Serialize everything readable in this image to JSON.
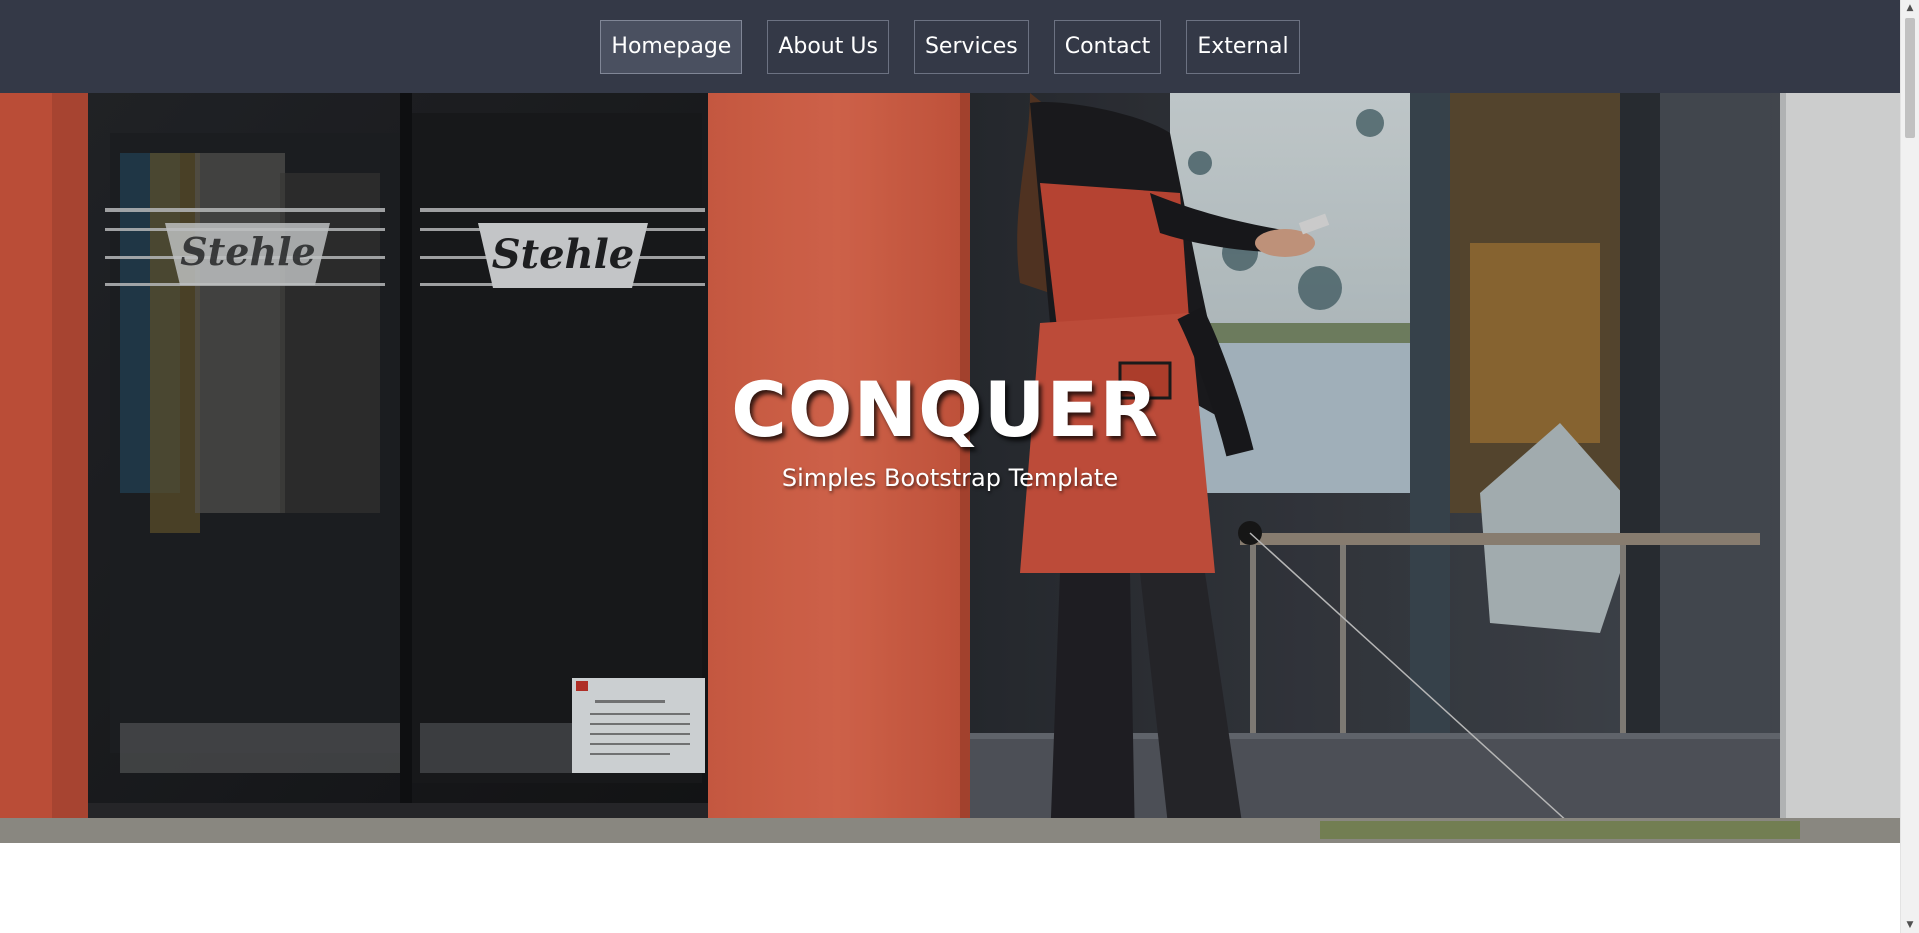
{
  "nav": {
    "items": [
      {
        "label": "Homepage",
        "active": true
      },
      {
        "label": "About Us",
        "active": false
      },
      {
        "label": "Services",
        "active": false
      },
      {
        "label": "Contact",
        "active": false
      },
      {
        "label": "External",
        "active": false
      }
    ]
  },
  "hero": {
    "title": "CONQUER",
    "subtitle": "Simples Bootstrap Template",
    "image_sign_text": "Stehle"
  },
  "colors": {
    "navbar_bg": "#343947",
    "hero_text": "#ffffff",
    "storefront_orange": "#e4644b"
  },
  "icons": {
    "scroll_up": "triangle-up",
    "scroll_down": "triangle-down"
  }
}
